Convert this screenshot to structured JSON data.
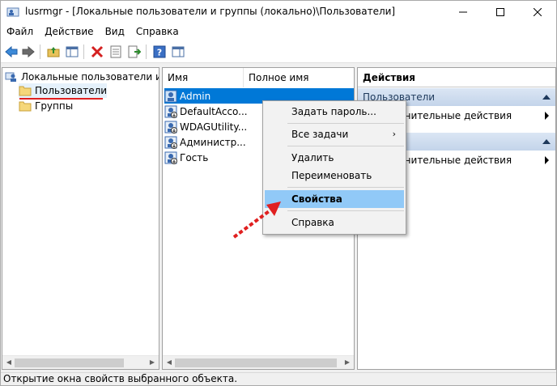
{
  "window": {
    "title": "lusrmgr - [Локальные пользователи и группы (локально)\\Пользователи]"
  },
  "menu": [
    "Файл",
    "Действие",
    "Вид",
    "Справка"
  ],
  "tree": {
    "root": "Локальные пользователи и гр",
    "items": [
      "Пользователи",
      "Группы"
    ]
  },
  "list": {
    "columns": [
      "Имя",
      "Полное имя"
    ],
    "rows": [
      "Admin",
      "DefaultAcco...",
      "WDAGUtility...",
      "Администр...",
      "Гость"
    ]
  },
  "actions": {
    "title": "Действия",
    "sections": [
      {
        "label": "Пользователи",
        "item": "лнительные действия"
      },
      {
        "label": "",
        "item": "лнительные действия"
      }
    ]
  },
  "context_menu": {
    "items": [
      "Задать пароль...",
      "Все задачи",
      "Удалить",
      "Переименовать",
      "Свойства",
      "Справка"
    ],
    "submenu_arrow": "›"
  },
  "status": "Открытие окна свойств выбранного объекта.",
  "colors": {
    "selection": "#0078d7",
    "highlight": "#91c9f7",
    "annotation": "#e02020"
  }
}
